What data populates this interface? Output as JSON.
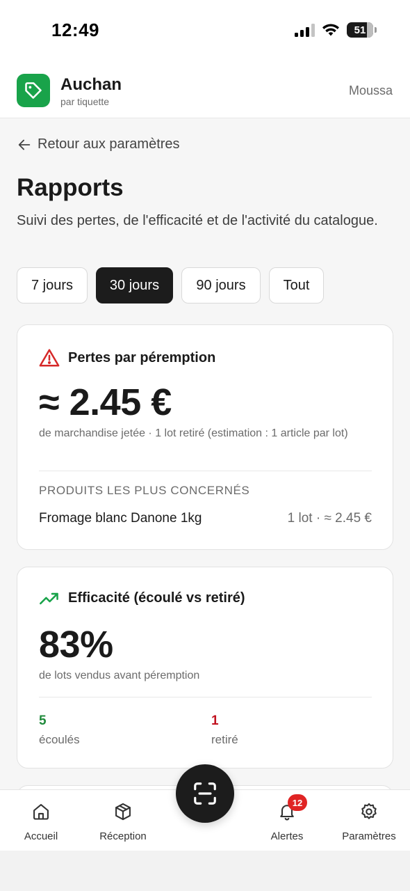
{
  "status_bar": {
    "time": "12:49",
    "battery": "51"
  },
  "header": {
    "brand": "Auchan",
    "brand_sub": "par tiquette",
    "user": "Moussa"
  },
  "back_link": "Retour aux paramètres",
  "page": {
    "title": "Rapports",
    "subtitle": "Suivi des pertes, de l'efficacité et de l'activité du catalogue."
  },
  "period_tabs": [
    {
      "label": "7 jours",
      "active": false
    },
    {
      "label": "30 jours",
      "active": true
    },
    {
      "label": "90 jours",
      "active": false
    },
    {
      "label": "Tout",
      "active": false
    }
  ],
  "losses_card": {
    "title": "Pertes par péremption",
    "value": "≈ 2.45 €",
    "description": "de marchandise jetée · 1 lot retiré (estimation : 1 article par lot)",
    "section_caption": "PRODUITS LES PLUS CONCERNÉS",
    "products": [
      {
        "name": "Fromage blanc Danone 1kg",
        "meta": "1 lot · ≈ 2.45 €"
      }
    ],
    "icon": "warning-triangle-icon",
    "icon_color": "#d62828"
  },
  "efficiency_card": {
    "title": "Efficacité (écoulé vs retiré)",
    "value": "83%",
    "description": "de lots vendus avant péremption",
    "sold": {
      "value": "5",
      "label": "écoulés",
      "color": "#1f8a3b"
    },
    "removed": {
      "value": "1",
      "label": "retiré",
      "color": "#c1121f"
    },
    "icon": "trending-up-icon",
    "icon_color": "#19a34a"
  },
  "bottom_nav": {
    "items": [
      {
        "label": "Accueil",
        "icon": "home-icon"
      },
      {
        "label": "Réception",
        "icon": "box-icon"
      },
      {
        "label": "Alertes",
        "icon": "bell-icon",
        "badge": "12"
      },
      {
        "label": "Paramètres",
        "icon": "gear-icon"
      }
    ],
    "scan_icon": "scan-icon"
  },
  "colors": {
    "brand": "#19a34a",
    "active_tab": "#1c1c1c",
    "badge": "#e02424"
  }
}
